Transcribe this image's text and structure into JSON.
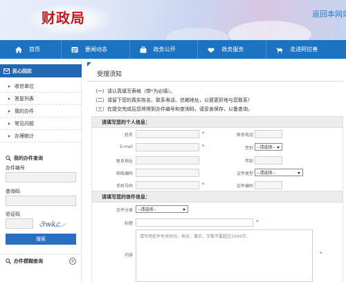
{
  "header": {
    "logo": "财政局",
    "home_link": "返回本网站"
  },
  "nav": {
    "items": [
      {
        "label": "首页",
        "icon": "home-icon"
      },
      {
        "label": "要闻动态",
        "icon": "news-icon"
      },
      {
        "label": "政务公开",
        "icon": "briefcase-icon"
      },
      {
        "label": "政务服务",
        "icon": "handshake-icon"
      },
      {
        "label": "走进阿拉善",
        "icon": "camel-icon"
      }
    ]
  },
  "sidebar": {
    "title": "民心回应",
    "items": [
      "收信单位",
      "答复列表",
      "我的办件",
      "常见问题",
      "办理统计"
    ],
    "query": {
      "title": "我的办件查询",
      "no_label": "办件编号",
      "pwd_label": "查询码",
      "captcha_label": "验证码",
      "captcha_text": "3wkc",
      "search_button": "搜索"
    },
    "bottom_title": "办件模糊查询",
    "plus": "+"
  },
  "content": {
    "title": "受理须知",
    "notice": [
      "（一）请认真填写表格（带*为必填）。",
      "（二）请留下您的真实姓名、联系电话、信箱地址，以便更好地与您联系！",
      "（三）在提交完成后您将得到办件编号和查询码，请妥善保存，以备查询。"
    ],
    "personal_head": "请填写您的个人信息：",
    "personal": {
      "name": "姓名",
      "phone": "联系电话",
      "email": "E-mail",
      "gender": "性别",
      "address": "联系地址",
      "age": "年龄",
      "zip": "邮政编码",
      "id_type": "证件类型",
      "mobile": "手机号码",
      "id_no": "证件编码",
      "select_default": "--请选择--"
    },
    "letter_head": "请填写您的信件信息：",
    "letter": {
      "category": "办件分类",
      "category_default": "--请选择--",
      "subject": "标题",
      "body": "内容",
      "body_placeholder": "请写明信件有关时间、地点、事实，字数不要超过1000字。"
    },
    "required_mark": "*"
  },
  "colors": {
    "nav_bg": "#1c73c1",
    "sidebar_head": "#2466b2",
    "logo_red": "#c8181e",
    "required": "#e0242b"
  }
}
